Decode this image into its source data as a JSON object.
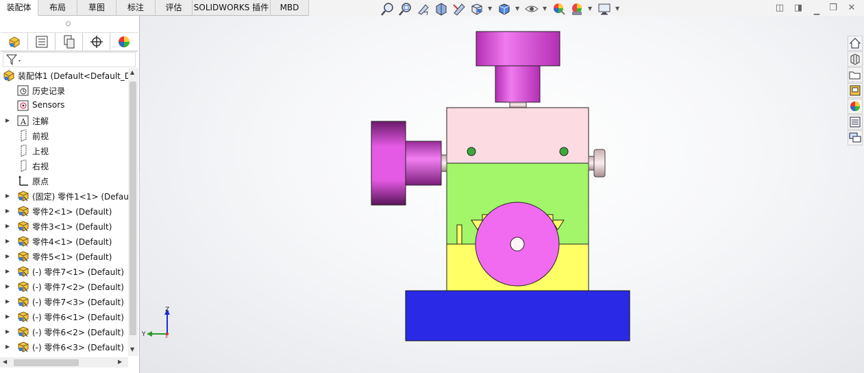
{
  "tabs": [
    "装配体",
    "布局",
    "草图",
    "标注",
    "评估",
    "SOLIDWORKS 插件",
    "MBD"
  ],
  "active_tab": "装配体",
  "toolbar_icons": [
    "zoom-to-fit-icon",
    "zoom-to-area-icon",
    "previous-view-icon",
    "section-view-icon",
    "dynamic-annotation-icon",
    "view-orientation-icon",
    "display-style-icon",
    "hide-show-icon",
    "edit-appearance-icon",
    "apply-scene-icon",
    "view-settings-icon"
  ],
  "window_buttons": [
    "◫",
    "◨",
    "❐",
    "✕"
  ],
  "tree": [
    {
      "label": "装配体1  (Default<Default_D",
      "icon": "assembly-icon",
      "level": 0,
      "expandable": false
    },
    {
      "label": "历史记录",
      "icon": "history-icon",
      "level": 1,
      "expandable": false
    },
    {
      "label": "Sensors",
      "icon": "sensors-icon",
      "level": 1,
      "expandable": false
    },
    {
      "label": "注解",
      "icon": "annotations-icon",
      "level": 1,
      "expandable": true
    },
    {
      "label": "前视",
      "icon": "plane-icon",
      "level": 1,
      "expandable": false
    },
    {
      "label": "上视",
      "icon": "plane-icon",
      "level": 1,
      "expandable": false
    },
    {
      "label": "右视",
      "icon": "plane-icon",
      "level": 1,
      "expandable": false
    },
    {
      "label": "原点",
      "icon": "origin-icon",
      "level": 1,
      "expandable": false
    },
    {
      "label": "(固定) 零件1<1> (Defau",
      "icon": "part-icon",
      "level": 1,
      "expandable": true
    },
    {
      "label": "零件2<1> (Default)",
      "icon": "part-icon",
      "level": 1,
      "expandable": true
    },
    {
      "label": "零件3<1> (Default)",
      "icon": "part-icon",
      "level": 1,
      "expandable": true
    },
    {
      "label": "零件4<1> (Default)",
      "icon": "part-icon",
      "level": 1,
      "expandable": true
    },
    {
      "label": "零件5<1> (Default)",
      "icon": "part-icon",
      "level": 1,
      "expandable": true
    },
    {
      "label": "(-) 零件7<1> (Default)",
      "icon": "part-icon",
      "level": 1,
      "expandable": true
    },
    {
      "label": "(-) 零件7<2> (Default)",
      "icon": "part-icon",
      "level": 1,
      "expandable": true
    },
    {
      "label": "(-) 零件7<3> (Default)",
      "icon": "part-icon",
      "level": 1,
      "expandable": true
    },
    {
      "label": "(-) 零件6<1> (Default)",
      "icon": "part-icon",
      "level": 1,
      "expandable": true
    },
    {
      "label": "(-) 零件6<2> (Default)",
      "icon": "part-icon",
      "level": 1,
      "expandable": true
    },
    {
      "label": "(-) 零件6<3> (Default)",
      "icon": "part-icon",
      "level": 1,
      "expandable": true
    }
  ],
  "right_toolbar_icons": [
    "home-icon",
    "design-library-icon",
    "file-explorer-icon",
    "view-palette-icon",
    "appearances-icon",
    "custom-properties-icon",
    "forum-icon"
  ],
  "triad": {
    "z": "Z",
    "y": "Y",
    "x": "X"
  },
  "colors": {
    "base": "#2a2ae6",
    "block_yellow": "#ffff66",
    "block_green": "#a3f56a",
    "block_pink": "#fddbe3",
    "magenta": "#e84de8",
    "wheel": "#f06bf0"
  }
}
